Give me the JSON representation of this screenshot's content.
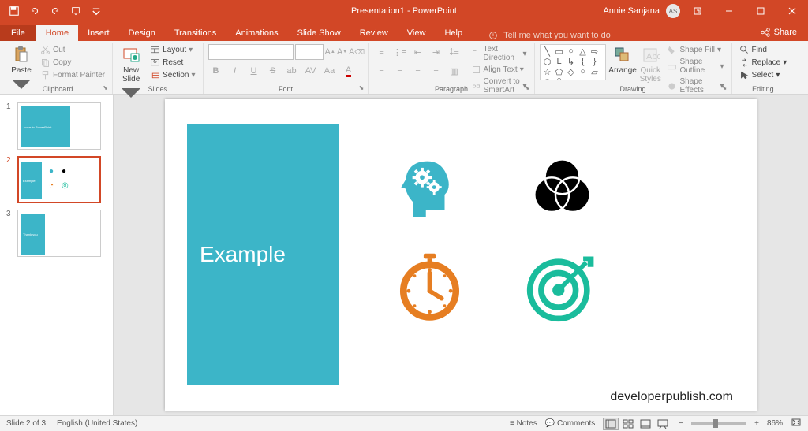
{
  "title": "Presentation1 - PowerPoint",
  "user": {
    "name": "Annie Sanjana",
    "initials": "AS"
  },
  "tabs": {
    "file": "File",
    "home": "Home",
    "insert": "Insert",
    "design": "Design",
    "transitions": "Transitions",
    "animations": "Animations",
    "slideshow": "Slide Show",
    "review": "Review",
    "view": "View",
    "help": "Help"
  },
  "tell_me": "Tell me what you want to do",
  "share": "Share",
  "clipboard": {
    "label": "Clipboard",
    "paste": "Paste",
    "cut": "Cut",
    "copy": "Copy",
    "format_painter": "Format Painter"
  },
  "slides": {
    "label": "Slides",
    "new_slide": "New\nSlide",
    "layout": "Layout",
    "reset": "Reset",
    "section": "Section"
  },
  "font": {
    "label": "Font"
  },
  "paragraph": {
    "label": "Paragraph",
    "text_direction": "Text Direction",
    "align_text": "Align Text",
    "smartart": "Convert to SmartArt"
  },
  "drawing": {
    "label": "Drawing",
    "arrange": "Arrange",
    "quick_styles": "Quick\nStyles",
    "shape_fill": "Shape Fill",
    "shape_outline": "Shape Outline",
    "shape_effects": "Shape Effects"
  },
  "editing": {
    "label": "Editing",
    "find": "Find",
    "replace": "Replace",
    "select": "Select"
  },
  "thumbs": {
    "t1": "1",
    "t1_title": "Icons in PowerPoint",
    "t2": "2",
    "t2_title": "Example",
    "t3": "3",
    "t3_title": "Thank you"
  },
  "slide": {
    "block_text": "Example",
    "watermark": "developerpublish.com"
  },
  "status": {
    "slide": "Slide 2 of 3",
    "lang": "English (United States)",
    "notes": "Notes",
    "comments": "Comments",
    "zoom": "86%"
  }
}
